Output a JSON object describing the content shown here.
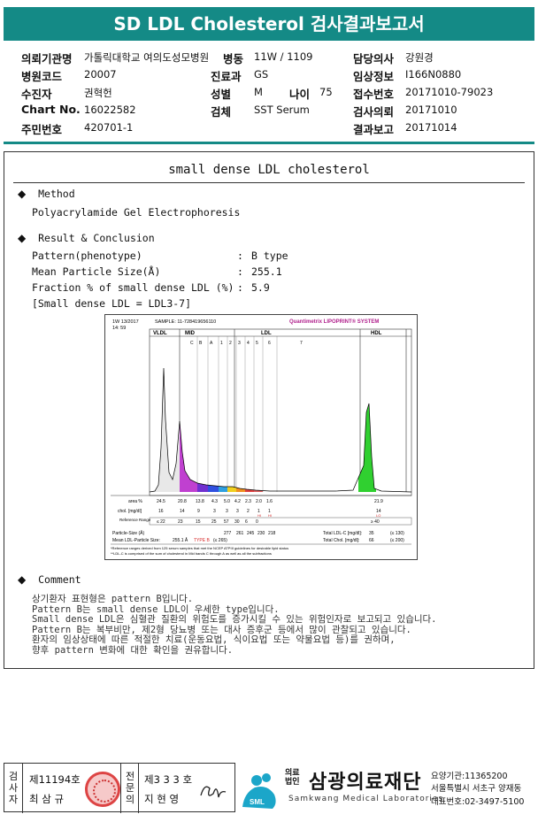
{
  "title": "SD LDL Cholesterol 검사결과보고서",
  "info": {
    "institution_label": "의뢰기관명",
    "institution_value": "가톨릭대학교 여의도성모병원",
    "ward_label": "병동",
    "ward_value": "11W / 1109",
    "doctor_label": "담당의사",
    "doctor_value": "강원경",
    "hospital_code_label": "병원코드",
    "hospital_code_value": "20007",
    "dept_label": "진료과",
    "dept_value": "GS",
    "clinical_label": "임상정보",
    "clinical_value": "I166N0880",
    "patient_label": "수진자",
    "patient_value": "권혁헌",
    "sex_label": "성별",
    "sex_value": "M",
    "age_label": "나이",
    "age_value": "75",
    "receipt_label": "접수번호",
    "receipt_value": "20171010-79023",
    "chart_label": "Chart No.",
    "chart_value": "16022582",
    "specimen_label": "검체",
    "specimen_value": "SST Serum",
    "request_label": "검사의뢰",
    "request_value": "20171010",
    "id_label": "주민번호",
    "id_value": "420701-1",
    "report_label": "결과보고",
    "report_value": "20171014"
  },
  "report": {
    "title": "small dense LDL cholesterol",
    "method_heading": "Method",
    "method_value": "Polyacrylamide Gel Electrophoresis",
    "result_heading": "Result & Conclusion",
    "rows": [
      {
        "label": "Pattern(phenotype)",
        "value": "B type"
      },
      {
        "label": "Mean Particle Size(Å)",
        "value": "255.1"
      },
      {
        "label": "Fraction % of small dense LDL (%)",
        "value": "5.9"
      }
    ],
    "sd_note": "[Small dense LDL = LDL3-7]",
    "comment_heading": "Comment",
    "comment_lines": [
      "상기환자 표현형은 pattern B입니다.",
      "Pattern B는 small dense LDL이 우세한 type입니다.",
      "Small dense LDL은 심혈관 질환의 위험도를 증가시킬 수 있는 위험인자로 보고되고 있습니다.",
      "Pattern B는 복부비만, 제2형 당뇨병 또는 대사 증후군 등에서 많이 관찰되고 있습니다.",
      "환자의 임상상태에 따른 적절한 치료(운동요법, 식이요법 또는 약물요법 등)를 권하며,",
      "향후 pattern 변화에 대한 확인을 권유합니다."
    ]
  },
  "lipoprint": {
    "date": "1W 13/2017",
    "time": "14: 59",
    "sample": "SAMPLE:  11-728419656110",
    "brand": "Quantimetrix LIPOPRINT® SYSTEM",
    "bands": [
      "VLDL",
      "MID",
      "LDL",
      "HDL"
    ],
    "sub_bands": [
      "C",
      "B",
      "A",
      "1",
      "2",
      "3",
      "4",
      "5",
      "6",
      "7"
    ],
    "area_label": "area %",
    "area_values": [
      "24.5",
      "20.8",
      "13.8",
      "4.3",
      "5.0",
      "4.2",
      "2.3",
      "2.0",
      "1.6",
      "21.9"
    ],
    "chol_label": "chol. [mg/dl]",
    "chol_values": [
      "16",
      "14",
      "9",
      "3",
      "3",
      "3",
      "2",
      "1",
      "1",
      "14"
    ],
    "flags": [
      "HI",
      "HI",
      "LO"
    ],
    "ref_label": "Reference Range",
    "ref_values": [
      "≤ 22",
      "23",
      "15",
      "25",
      "57",
      "30",
      "6",
      "0",
      "≥ 40"
    ],
    "particle_label": "Particle-Size (Å)",
    "particle_values": [
      "277",
      "261",
      "245",
      "230",
      "218"
    ],
    "mean_label": "Mean LDL-Particle Size:",
    "mean_value": "255.1 Å",
    "type_value": "TYPE B",
    "type_ref": "(≤ 265)",
    "total_ldl_label": "Total LDL-C [mg/dl]:",
    "total_ldl_value": "35",
    "total_ldl_ref": "(≤ 130)",
    "total_chol_label": "Total Chol. [mg/dl]:",
    "total_chol_value": "66",
    "total_chol_ref": "(≤ 200)",
    "footnote1": "*Reference ranges derived from 125 serum samples that met the NCEP ATPIII guidelines for desirable lipid status",
    "footnote2": "**LDL-C is comprised of the sum of cholesterol in Mid bands C through A as well as all the subfractions"
  },
  "footer": {
    "label1_vertical": "검사자",
    "doc_no1": "제11194호",
    "person1": "최 삼 규",
    "label2_vertical": "전문의",
    "doc_no2": "제3 3 3 호",
    "person2": "지 현 영",
    "legal": "의료법인",
    "org_name": "삼광의료재단",
    "org_sub": "Samkwang Medical Laboratories",
    "logo_text": "SML",
    "org_code": "요양기관:11365200",
    "org_address": "서울특별시 서초구 양재동",
    "org_phone": "대표번호:02-3497-5100"
  },
  "colors": {
    "header": "#148a86",
    "flag": "#d62828",
    "type_b": "#d62828"
  }
}
